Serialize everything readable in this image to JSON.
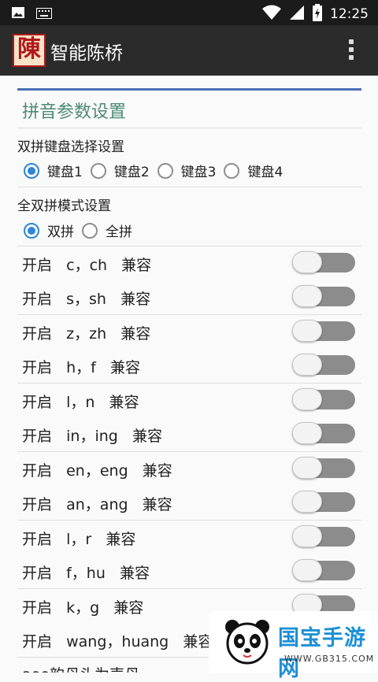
{
  "status_bar": {
    "time": "12:25",
    "left_icons": [
      "image-icon",
      "keyboard-icon"
    ],
    "right_icons": [
      "wifi-icon",
      "signal-icon",
      "battery-charging-icon"
    ]
  },
  "app_bar": {
    "logo_char": "陳",
    "title": "智能陈桥",
    "overflow_icon": "more-vert-icon"
  },
  "section": {
    "title": "拼音参数设置",
    "accent_color": "#4a6fb5",
    "title_color": "#4c8a76"
  },
  "keyboard_group": {
    "label": "双拼键盘选择设置",
    "options": [
      {
        "label": "键盘1",
        "selected": true
      },
      {
        "label": "键盘2",
        "selected": false
      },
      {
        "label": "键盘3",
        "selected": false
      },
      {
        "label": "键盘4",
        "selected": false
      }
    ]
  },
  "mode_group": {
    "label": "全双拼模式设置",
    "options": [
      {
        "label": "双拼",
        "selected": true
      },
      {
        "label": "全拼",
        "selected": false
      }
    ]
  },
  "toggles": [
    {
      "label": "开启   c，ch   兼容",
      "on": false
    },
    {
      "label": "开启   s，sh   兼容",
      "on": false
    },
    {
      "label": "开启   z，zh   兼容",
      "on": false
    },
    {
      "label": "开启   h，f   兼容",
      "on": false
    },
    {
      "label": "开启   l，n   兼容",
      "on": false
    },
    {
      "label": "开启   in，ing   兼容",
      "on": false
    },
    {
      "label": "开启   en，eng   兼容",
      "on": false
    },
    {
      "label": "开启   an，ang   兼容",
      "on": false
    },
    {
      "label": "开启   l，r   兼容",
      "on": false
    },
    {
      "label": "开启   f，hu   兼容",
      "on": false
    },
    {
      "label": "开启   k，g   兼容",
      "on": false
    },
    {
      "label": "开启   wang，huang   兼容",
      "on": false
    }
  ],
  "bottom_partial_text": "aoe韵母头为声母",
  "watermark": {
    "text": "国宝手游网",
    "url": "WWW.GB315.COM"
  },
  "colors": {
    "radio_on": "#2f86d4",
    "switch_track": "#8c8c8c",
    "app_bar": "#2b2b2b"
  }
}
